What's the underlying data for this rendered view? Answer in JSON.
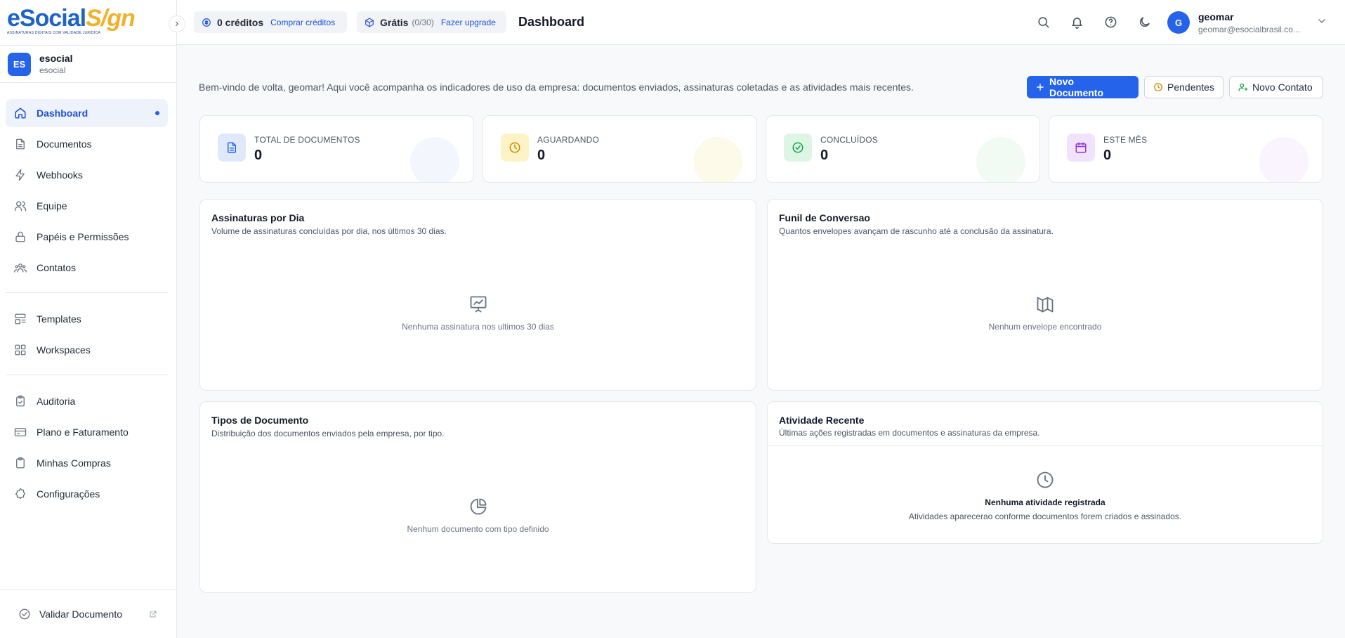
{
  "brand": {
    "logo_left": "eSocial",
    "logo_right": "S/gn",
    "tagline": "Assinaturas digitais com validade jurídica"
  },
  "org": {
    "initials": "ES",
    "name": "esocial",
    "sub": "esocial"
  },
  "nav": {
    "group1": [
      {
        "label": "Dashboard",
        "icon": "home-icon",
        "active": true
      },
      {
        "label": "Documentos",
        "icon": "document-icon"
      },
      {
        "label": "Webhooks",
        "icon": "bolt-icon"
      },
      {
        "label": "Equipe",
        "icon": "users-icon"
      },
      {
        "label": "Papéis e Permissões",
        "icon": "lock-icon"
      },
      {
        "label": "Contatos",
        "icon": "contacts-icon"
      }
    ],
    "group2": [
      {
        "label": "Templates",
        "icon": "template-icon"
      },
      {
        "label": "Workspaces",
        "icon": "grid-icon"
      }
    ],
    "group3": [
      {
        "label": "Auditoria",
        "icon": "clipboard-icon"
      },
      {
        "label": "Plano e Faturamento",
        "icon": "card-icon"
      },
      {
        "label": "Minhas Compras",
        "icon": "clipboard-list-icon"
      },
      {
        "label": "Configurações",
        "icon": "gear-icon"
      }
    ]
  },
  "validate": {
    "label": "Validar Documento"
  },
  "topbar": {
    "credits": "0 créditos",
    "buy_credits": "Comprar créditos",
    "plan": "Grátis",
    "plan_usage": "(0/30)",
    "upgrade": "Fazer upgrade",
    "title": "Dashboard"
  },
  "user": {
    "initial": "G",
    "name": "geomar",
    "email": "geomar@esocialbrasil.co..."
  },
  "welcome": "Bem-vindo de volta, geomar! Aqui você acompanha os indicadores de uso da empresa: documentos enviados, assinaturas coletadas e as atividades mais recentes.",
  "actions": {
    "new_document": "Novo Documento",
    "pending": "Pendentes",
    "new_contact": "Novo Contato"
  },
  "stats": [
    {
      "label": "TOTAL DE DOCUMENTOS",
      "value": "0",
      "color": "#2563eb",
      "bg": "#e0e9fb"
    },
    {
      "label": "AGUARDANDO",
      "value": "0",
      "color": "#ca8a04",
      "bg": "#fdf3c7"
    },
    {
      "label": "CONCLUÍDOS",
      "value": "0",
      "color": "#16a34a",
      "bg": "#dcf5e4"
    },
    {
      "label": "ESTE MÊS",
      "value": "0",
      "color": "#9333ea",
      "bg": "#f1e3fc"
    }
  ],
  "cards": {
    "signatures": {
      "title": "Assinaturas por Dia",
      "sub": "Volume de assinaturas concluídas por dia, nos últimos 30 dias.",
      "empty": "Nenhuma assinatura nos ultimos 30 dias"
    },
    "funnel": {
      "title": "Funil de Conversao",
      "sub": "Quantos envelopes avançam de rascunho até a conclusão da assinatura.",
      "empty": "Nenhum envelope encontrado"
    },
    "types": {
      "title": "Tipos de Documento",
      "sub": "Distribuição dos documentos enviados pela empresa, por tipo.",
      "empty": "Nenhum documento com tipo definido"
    },
    "activity": {
      "title": "Atividade Recente",
      "sub": "Últimas ações registradas em documentos e assinaturas da empresa.",
      "empty_title": "Nenhuma atividade registrada",
      "empty_sub": "Atividades aparecerao conforme documentos forem criados e assinados."
    }
  }
}
